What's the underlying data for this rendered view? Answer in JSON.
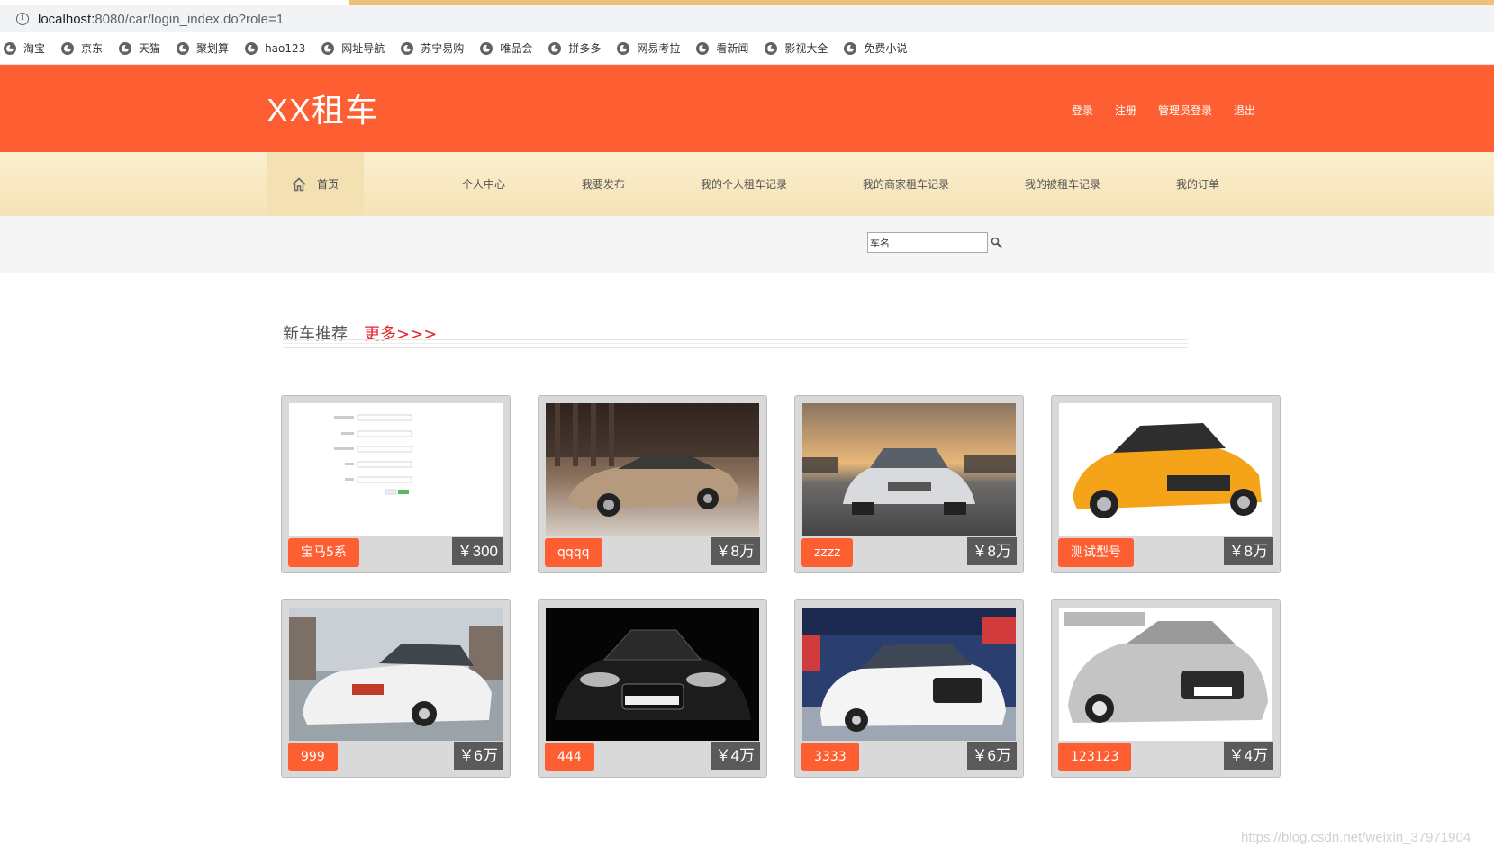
{
  "browser": {
    "url_host": "localhost:",
    "url_path": "8080/car/login_index.do?role=1",
    "bookmarks": [
      "淘宝",
      "京东",
      "天猫",
      "聚划算",
      "hao123",
      "网址导航",
      "苏宁易购",
      "唯品会",
      "拼多多",
      "网易考拉",
      "看新闻",
      "影视大全",
      "免费小说"
    ]
  },
  "header": {
    "logo": "XX租车",
    "links": [
      "登录",
      "注册",
      "管理员登录",
      "退出"
    ]
  },
  "nav": {
    "home": "首页",
    "items": [
      "个人中心",
      "我要发布",
      "我的个人租车记录",
      "我的商家租车记录",
      "我的被租车记录",
      "我的订单"
    ]
  },
  "search": {
    "value": "车名"
  },
  "section": {
    "title": "新车推荐",
    "more": "更多>>>"
  },
  "cars": [
    {
      "name": "宝马5系",
      "price": "￥300",
      "image": "form-screenshot"
    },
    {
      "name": "qqqq",
      "price": "￥8万",
      "image": "gold-sedan"
    },
    {
      "name": "zzzz",
      "price": "￥8万",
      "image": "silver-sedan-front"
    },
    {
      "name": "测试型号",
      "price": "￥8万",
      "image": "orange-hatchback"
    },
    {
      "name": "999",
      "price": "￥6万",
      "image": "white-sedan-rear"
    },
    {
      "name": "444",
      "price": "￥4万",
      "image": "black-sports-car"
    },
    {
      "name": "3333",
      "price": "￥6万",
      "image": "white-luxury-sedan"
    },
    {
      "name": "123123",
      "price": "￥4万",
      "image": "grey-sports-car"
    }
  ],
  "watermark": "https://blog.csdn.net/weixin_37971904",
  "colors": {
    "brand": "#fe5f32",
    "nav_bg": "#f6e3b6",
    "price_bg": "#5a5a5a",
    "more_link": "#e0262b"
  }
}
